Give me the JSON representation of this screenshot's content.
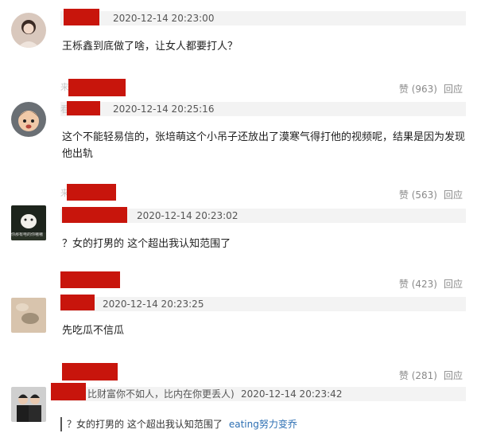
{
  "comments": [
    {
      "timestamp": "2020-12-14 20:23:00",
      "text": "王栎鑫到底做了啥，让女人都要打人？"
    },
    {
      "timestamp": "2020-12-14 20:25:16",
      "text": "这个不能轻易信的，张培萌这个小吊子还放出了漠寒气得打他的视频呢，结果是因为发现他出轨",
      "likes": "赞 (963)",
      "reply": "回应",
      "faint_prefix": "来",
      "faint_prefix2": "看"
    },
    {
      "timestamp": "2020-12-14 20:23:02",
      "text": "？女的打男的 这个超出我认知范围了",
      "likes": "赞 (563)",
      "reply": "回应",
      "faint_prefix": "来",
      "avatar_caption": "你那有电的你嗷嗷"
    },
    {
      "timestamp": "2020-12-14 20:23:25",
      "text": "先吃瓜不信瓜",
      "likes": "赞 (423)",
      "reply": "回应"
    },
    {
      "timestamp": "2020-12-14 20:23:42",
      "username_visible": "比财富你不如人，比内在你更丢人)",
      "likes": "赞 (281)",
      "reply": "回应",
      "quote": {
        "text": "？女的打男的 这个超出我认知范围了",
        "user": "eating努力变乔"
      }
    }
  ],
  "colors": {
    "redaction": "#c8150c",
    "meta_bar": "#f3f3f3",
    "link": "#2d6fb3",
    "muted": "#8a8a8a"
  }
}
